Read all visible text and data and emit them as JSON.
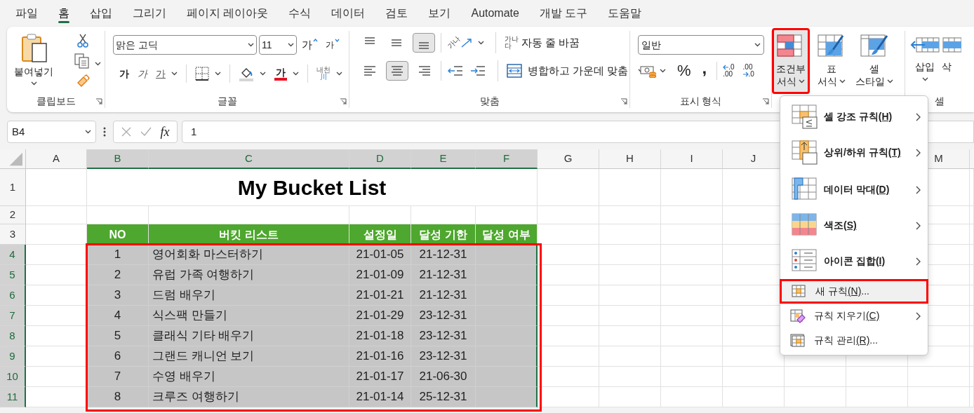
{
  "menu_tabs": [
    {
      "label": "파일",
      "selected": false
    },
    {
      "label": "홈",
      "selected": true
    },
    {
      "label": "삽입",
      "selected": false
    },
    {
      "label": "그리기",
      "selected": false
    },
    {
      "label": "페이지 레이아웃",
      "selected": false
    },
    {
      "label": "수식",
      "selected": false
    },
    {
      "label": "데이터",
      "selected": false
    },
    {
      "label": "검토",
      "selected": false
    },
    {
      "label": "보기",
      "selected": false
    },
    {
      "label": "Automate",
      "selected": false
    },
    {
      "label": "개발 도구",
      "selected": false
    },
    {
      "label": "도움말",
      "selected": false
    }
  ],
  "clipboard": {
    "paste": "붙여넣기",
    "label": "클립보드"
  },
  "font": {
    "face": "맑은 고딕",
    "size": "11",
    "grow": "가",
    "shrink": "가",
    "bold": "가",
    "italic": "가",
    "underline": "가",
    "font_color": "가",
    "phonetic": [
      "내천",
      "川"
    ],
    "label": "글꼴"
  },
  "alignment": {
    "orientation_icon_text": "가나",
    "wrap_icon_text": [
      "가나",
      "다"
    ],
    "wrap": "자동 줄 바꿈",
    "merge": "병합하고 가운데 맞춤",
    "label": "맞춤"
  },
  "number": {
    "format": "일반",
    "percent": "%",
    "comma": ",",
    "increase_decimal": [
      ".0",
      ".00"
    ],
    "decrease_decimal": [
      ".00",
      ".0"
    ],
    "label": "표시 형식"
  },
  "styles": [
    {
      "lines": [
        "조건부",
        "서식"
      ],
      "selected": true,
      "annotated": true
    },
    {
      "lines": [
        "표",
        "서식"
      ],
      "selected": false,
      "annotated": false
    },
    {
      "lines": [
        "셀",
        "스타일"
      ],
      "selected": false,
      "annotated": false
    }
  ],
  "cells": {
    "insert": "삽입",
    "delete": "삭",
    "label": "셀"
  },
  "formula_bar": {
    "name_box": "B4",
    "fx": "fx",
    "value": "1"
  },
  "columns": [
    {
      "label": "A",
      "selected": false
    },
    {
      "label": "B",
      "selected": true
    },
    {
      "label": "C",
      "selected": true
    },
    {
      "label": "D",
      "selected": true
    },
    {
      "label": "E",
      "selected": true
    },
    {
      "label": "F",
      "selected": true
    },
    {
      "label": "G",
      "selected": false
    },
    {
      "label": "H",
      "selected": false
    },
    {
      "label": "I",
      "selected": false
    },
    {
      "label": "J",
      "selected": false
    },
    {
      "label": "M",
      "selected": false
    }
  ],
  "row_numbers": [
    {
      "label": "1",
      "selected": false
    },
    {
      "label": "2",
      "selected": false
    },
    {
      "label": "3",
      "selected": false
    },
    {
      "label": "4",
      "selected": true
    },
    {
      "label": "5",
      "selected": true
    },
    {
      "label": "6",
      "selected": true
    },
    {
      "label": "7",
      "selected": true
    },
    {
      "label": "8",
      "selected": true
    },
    {
      "label": "9",
      "selected": true
    },
    {
      "label": "10",
      "selected": true
    },
    {
      "label": "11",
      "selected": true
    }
  ],
  "sheet": {
    "title": "My Bucket List",
    "headers": [
      "NO",
      "버킷 리스트",
      "설정일",
      "달성 기한",
      "달성 여부"
    ],
    "annotated": true,
    "rows": [
      [
        "1",
        "영어회화 마스터하기",
        "21-01-05",
        "21-12-31"
      ],
      [
        "2",
        "유럽 가족 여행하기",
        "21-01-09",
        "21-12-31"
      ],
      [
        "3",
        "드럼 배우기",
        "21-01-21",
        "21-12-31"
      ],
      [
        "4",
        "식스팩 만들기",
        "21-01-29",
        "23-12-31"
      ],
      [
        "5",
        "클래식 기타 배우기",
        "21-01-18",
        "23-12-31"
      ],
      [
        "6",
        "그랜드 캐니언 보기",
        "21-01-16",
        "23-12-31"
      ],
      [
        "7",
        "수영 배우기",
        "21-01-17",
        "21-06-30"
      ],
      [
        "8",
        "크루즈 여행하기",
        "21-01-14",
        "25-12-31"
      ]
    ]
  },
  "context_menu": [
    {
      "kind": "large",
      "label": "셀 강조 규칙",
      "key": "(H)",
      "submenu": true,
      "selected": false,
      "annotated": false
    },
    {
      "kind": "large",
      "label": "상위/하위 규칙",
      "key": "(T)",
      "submenu": true,
      "selected": false,
      "annotated": false
    },
    {
      "kind": "large",
      "label": "데이터 막대",
      "key": "(D)",
      "submenu": true,
      "selected": false,
      "annotated": false
    },
    {
      "kind": "large",
      "label": "색조",
      "key": "(S)",
      "submenu": true,
      "selected": false,
      "annotated": false
    },
    {
      "kind": "large",
      "label": "아이콘 집합",
      "key": "(I)",
      "submenu": true,
      "selected": false,
      "annotated": false
    },
    {
      "kind": "small",
      "label": "새 규칙",
      "key": "(N)",
      "suffix": "...",
      "submenu": false,
      "selected": true,
      "annotated": true
    },
    {
      "kind": "small",
      "label": "규칙 지우기",
      "key": "(C)",
      "submenu": true,
      "selected": false,
      "annotated": false
    },
    {
      "kind": "small",
      "label": "규칙 관리",
      "key": "(R)",
      "suffix": "...",
      "submenu": false,
      "selected": false,
      "annotated": false
    }
  ]
}
